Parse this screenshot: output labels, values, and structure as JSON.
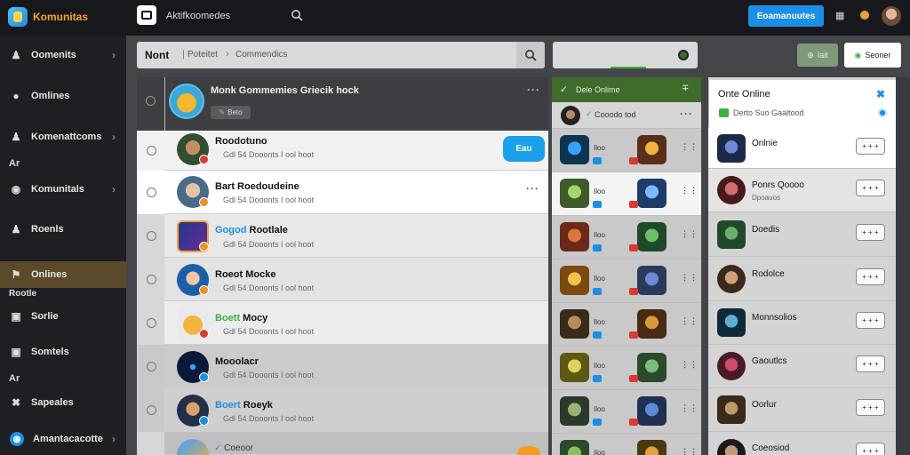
{
  "app": {
    "title": "Komunitas"
  },
  "topbar": {
    "title": "Aktifkoomedes",
    "primary_button": "Eoamanuutes"
  },
  "sidebar": {
    "items": [
      {
        "label": "Oomenits",
        "icon": "user-icon"
      },
      {
        "label": "Omlines",
        "icon": "chat-icon"
      },
      {
        "label": "Komenattcoms",
        "icon": "user-icon"
      },
      {
        "label": "Komunitals",
        "icon": "group-icon"
      },
      {
        "label": "Roenls",
        "icon": "user-icon"
      },
      {
        "label": "Onlines",
        "icon": "flag-icon"
      },
      {
        "label": "Sorlie",
        "icon": "image-icon"
      },
      {
        "label": "Somtels",
        "icon": "image-icon"
      },
      {
        "label": "Sapeales",
        "icon": "close-icon"
      },
      {
        "label": "Amantacacotte",
        "icon": "globe-icon"
      }
    ],
    "small_labels": [
      "Ar",
      "Rootle",
      "Ar"
    ]
  },
  "toolbar": {
    "breadcrumb_root": "Nont",
    "breadcrumb_1": "Poteitet",
    "breadcrumb_2": "Commendics"
  },
  "mid_toolbar": {},
  "right_toolbar": {
    "add_label": "Iait",
    "save_label": "Seoner"
  },
  "list_header": {
    "title": "Monk Gommemies Griecik hock",
    "tag": "Beto"
  },
  "list": [
    {
      "name": "Roodotuno",
      "sub": "Gdl 54 Dooonts I ool hoot",
      "action": "Eau"
    },
    {
      "name": "Bart Roedoudeine",
      "sub": "Gdl 54 Dooonts I ool hoot"
    },
    {
      "name_accent": "Gogod",
      "name": "Rootlale",
      "sub": "Gdl 54 Dooonts I ool hoot"
    },
    {
      "name": "Roeot Mocke",
      "sub": "Gdl 54 Dooonts I ool hoot"
    },
    {
      "name_accent": "Boett",
      "name": "Mocy",
      "sub": "Gdl 54 Dooonts I ool hoot"
    },
    {
      "name": "Mooolacr",
      "sub": "Gdl 54 Dooonts I ool hoot"
    },
    {
      "name_accent": "Boert",
      "name": "Roeyk",
      "sub": "Gdl 54 Dooonts I ool hoot"
    },
    {
      "name": "Coeoor",
      "sub": ""
    }
  ],
  "grid_panel": {
    "title": "Dele Onlime",
    "sub_header": "Cooodo tod",
    "cells_label": "Iloo"
  },
  "online_panel": {
    "title": "Onte Online",
    "subtitle": "Derto Suo Gaaltood",
    "pill_label": "+ + +",
    "rows": [
      {
        "name": "Onlnie"
      },
      {
        "name": "Ponrs Qoooo",
        "sub": "Dpoauos"
      },
      {
        "name": "Doedis"
      },
      {
        "name": "Rodolce"
      },
      {
        "name": "Monnsolios"
      },
      {
        "name": "Gaoutlcs"
      },
      {
        "name": "Oorlur"
      },
      {
        "name": "Coeosiod"
      }
    ]
  },
  "colors": {
    "accent": "#1b8fe6",
    "online_green": "#3f6b2b",
    "active_nav": "#5b4a2a",
    "badge_red": "#d93b2f",
    "badge_orange": "#e8922c",
    "badge_green": "#3cb043",
    "badge_blue": "#1b8fe6"
  }
}
